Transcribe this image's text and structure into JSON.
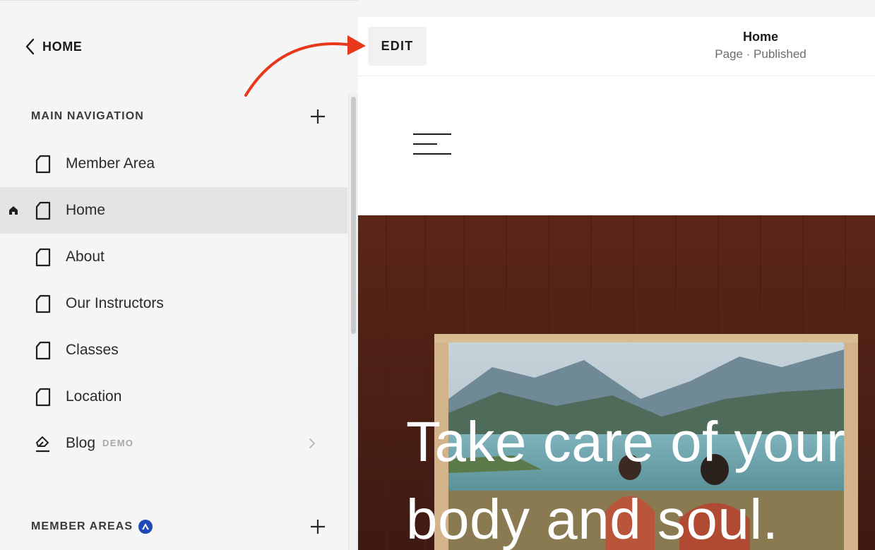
{
  "sidebar": {
    "back_label": "HOME",
    "main_nav": {
      "title": "MAIN NAVIGATION",
      "items": [
        {
          "label": "Member Area"
        },
        {
          "label": "Home"
        },
        {
          "label": "About"
        },
        {
          "label": "Our Instructors"
        },
        {
          "label": "Classes"
        },
        {
          "label": "Location"
        },
        {
          "label": "Blog",
          "tag": "DEMO"
        }
      ]
    },
    "member_areas": {
      "title": "MEMBER AREAS"
    }
  },
  "toolbar": {
    "edit_label": "EDIT",
    "page_title": "Home",
    "page_status": "Page · Published"
  },
  "hero": {
    "heading_line1": "Take care of your",
    "heading_line2": "body and soul."
  },
  "colors": {
    "accent_arrow": "#e8371b",
    "badge_blue": "#1f47b8",
    "active_row": "#e4e4e4"
  }
}
